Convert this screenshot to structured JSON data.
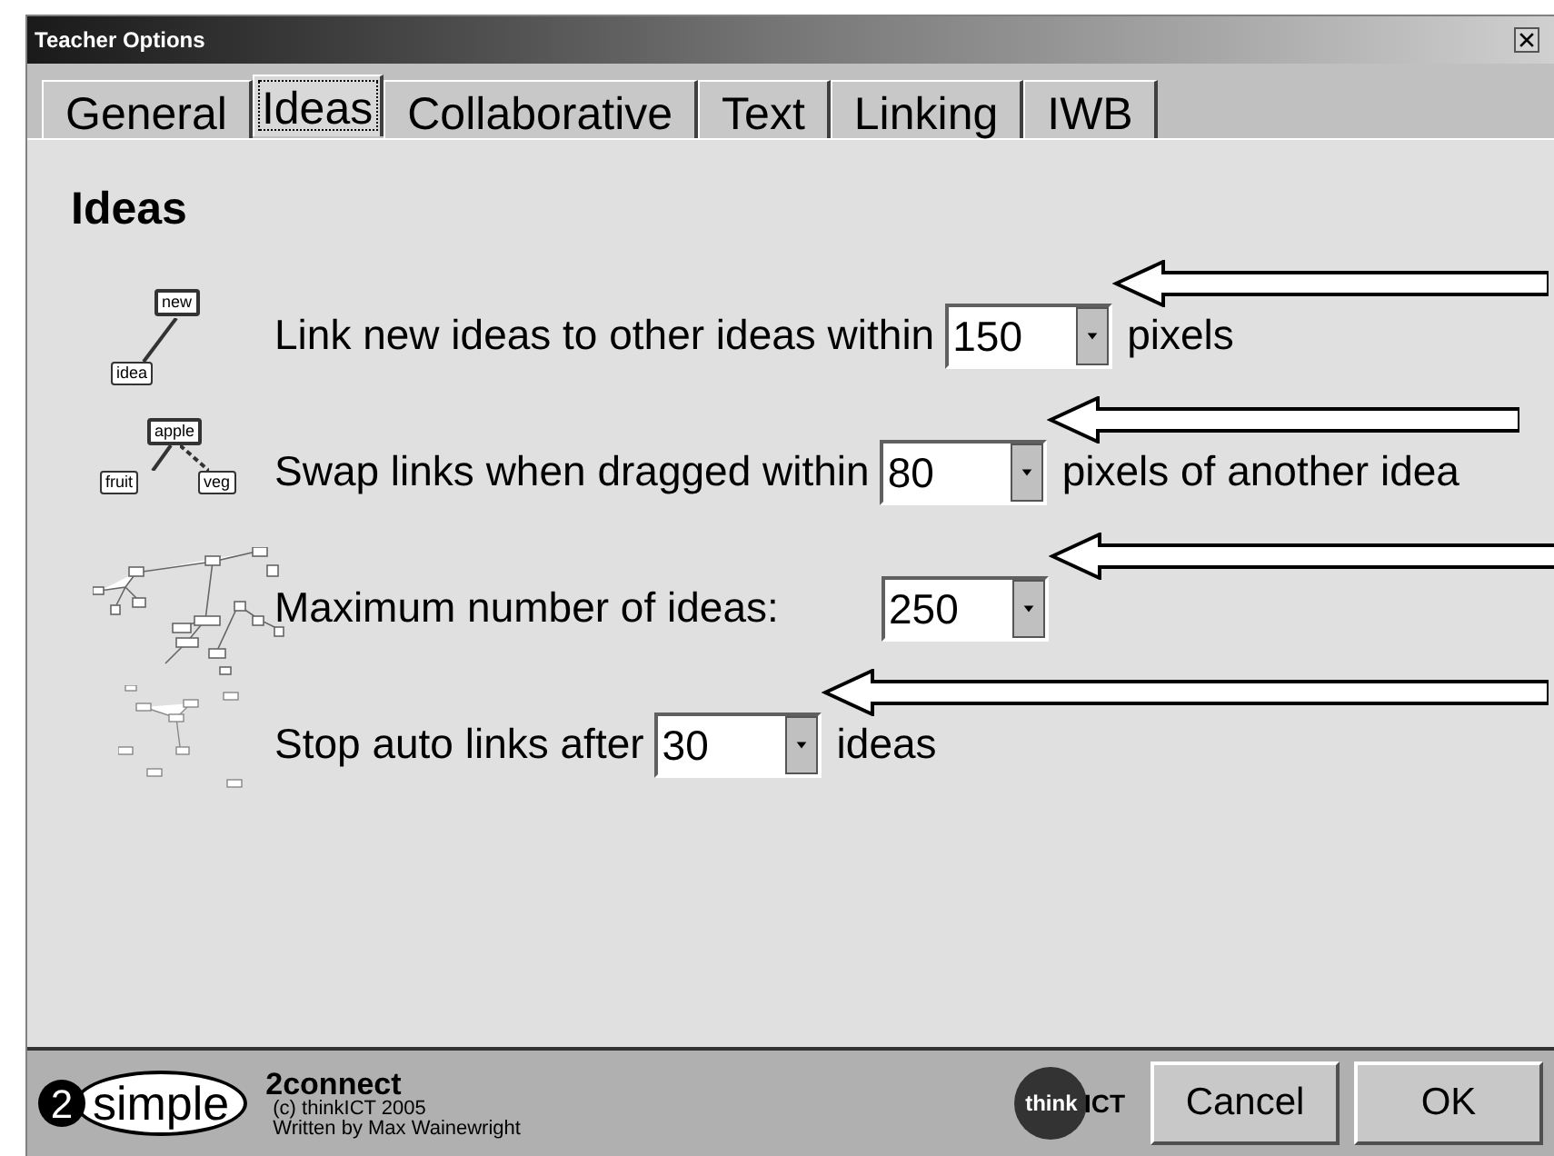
{
  "window": {
    "title": "Teacher Options"
  },
  "tabs": [
    {
      "label": "General",
      "selected": false
    },
    {
      "label": "Ideas",
      "selected": true
    },
    {
      "label": "Collaborative",
      "selected": false
    },
    {
      "label": "Text",
      "selected": false
    },
    {
      "label": "Linking",
      "selected": false
    },
    {
      "label": "IWB",
      "selected": false
    }
  ],
  "heading": "Ideas",
  "settings": [
    {
      "kind": "link",
      "diagram_labels": [
        "new",
        "idea"
      ],
      "label": "Link new ideas to other ideas within",
      "value": "150",
      "suffix": "pixels"
    },
    {
      "kind": "swap",
      "diagram_labels": [
        "apple",
        "fruit",
        "veg"
      ],
      "label": "Swap links when dragged within",
      "value": "80",
      "suffix": "pixels of another idea"
    },
    {
      "kind": "max",
      "label": "Maximum number of ideas:",
      "value": "250"
    },
    {
      "kind": "stop",
      "label": "Stop auto links after",
      "value": "30",
      "suffix": "ideas"
    }
  ],
  "footer": {
    "logo": [
      "2",
      "simple"
    ],
    "app_name": "2connect",
    "copyright": "(c) thinkICT 2005",
    "author": "Written by Max Wainewright",
    "partner_logo": [
      "think",
      "ICT"
    ],
    "buttons": [
      "Cancel",
      "OK"
    ]
  }
}
